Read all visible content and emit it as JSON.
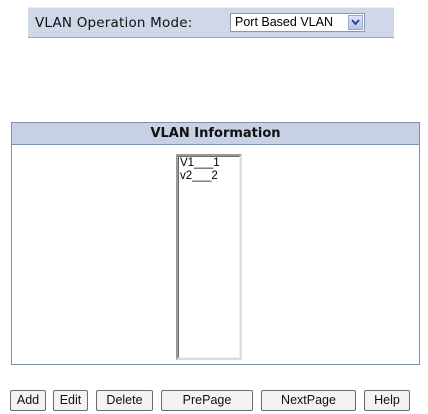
{
  "mode": {
    "label": "VLAN Operation Mode:",
    "selected": "Port Based VLAN",
    "arrow_icon": "chevron-down-icon"
  },
  "panel": {
    "title": "VLAN Information",
    "items": [
      "V1___1",
      "v2___2"
    ]
  },
  "buttons": {
    "add": "Add",
    "edit": "Edit",
    "delete": "Delete",
    "prepage": "PrePage",
    "nextpage": "NextPage",
    "help": "Help"
  },
  "colors": {
    "header_bg": "#c7d1e6",
    "border": "#7e8fb5"
  }
}
